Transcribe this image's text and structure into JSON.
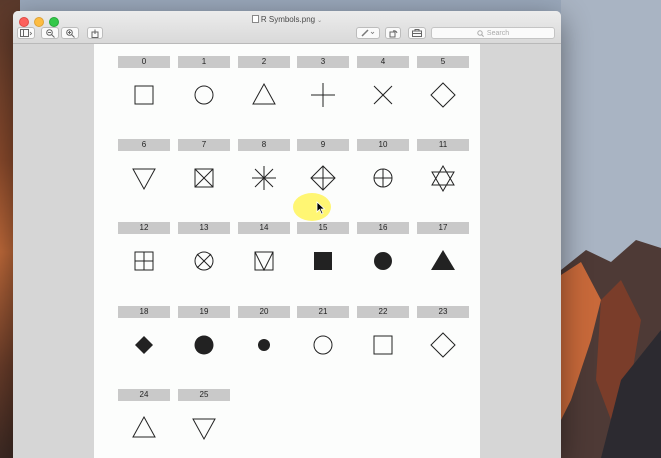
{
  "window": {
    "title": "R Symbols.png",
    "search_placeholder": "Search"
  },
  "symbols": [
    {
      "label": "0",
      "shape": "open-square"
    },
    {
      "label": "1",
      "shape": "open-circle"
    },
    {
      "label": "2",
      "shape": "open-triangle-up"
    },
    {
      "label": "3",
      "shape": "plus"
    },
    {
      "label": "4",
      "shape": "cross"
    },
    {
      "label": "5",
      "shape": "open-diamond"
    },
    {
      "label": "6",
      "shape": "open-triangle-down"
    },
    {
      "label": "7",
      "shape": "square-cross"
    },
    {
      "label": "8",
      "shape": "asterisk"
    },
    {
      "label": "9",
      "shape": "diamond-plus"
    },
    {
      "label": "10",
      "shape": "circle-plus"
    },
    {
      "label": "11",
      "shape": "star-of-david"
    },
    {
      "label": "12",
      "shape": "square-plus"
    },
    {
      "label": "13",
      "shape": "circle-cross"
    },
    {
      "label": "14",
      "shape": "square-triangle"
    },
    {
      "label": "15",
      "shape": "filled-square"
    },
    {
      "label": "16",
      "shape": "filled-circle"
    },
    {
      "label": "17",
      "shape": "filled-triangle"
    },
    {
      "label": "18",
      "shape": "filled-diamond"
    },
    {
      "label": "19",
      "shape": "filled-circle-large"
    },
    {
      "label": "20",
      "shape": "filled-circle-small"
    },
    {
      "label": "21",
      "shape": "open-circle"
    },
    {
      "label": "22",
      "shape": "open-square"
    },
    {
      "label": "23",
      "shape": "open-diamond"
    },
    {
      "label": "24",
      "shape": "open-triangle-up"
    },
    {
      "label": "25",
      "shape": "open-triangle-down"
    }
  ]
}
